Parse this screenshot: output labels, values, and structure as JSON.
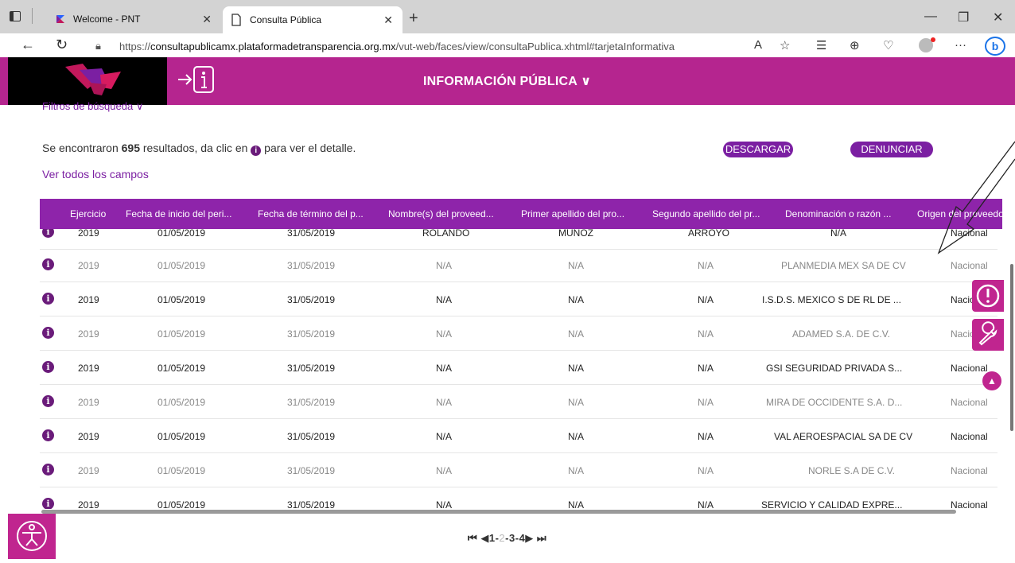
{
  "browser": {
    "tabs": [
      {
        "title": "Welcome - PNT",
        "active": false
      },
      {
        "title": "Consulta Pública",
        "active": true
      }
    ],
    "url_prefix": "https://",
    "url_host": "consultapublicamx.plataformadetransparencia.org.mx",
    "url_path": "/vut-web/faces/view/consultaPublica.xhtml#tarjetaInformativa"
  },
  "header": {
    "title": "INFORMACIÓN PÚBLICA"
  },
  "filters_label": "Filtros de búsqueda",
  "results": {
    "prefix": "Se encontraron ",
    "count": "695",
    "middle": " resultados, da clic en ",
    "suffix": " para ver el detalle."
  },
  "buttons": {
    "download": "DESCARGAR",
    "report": "DENUNCIAR"
  },
  "view_all": "Ver todos los campos",
  "table": {
    "headers": [
      "Ejercicio",
      "Fecha de inicio del peri...",
      "Fecha de término del p...",
      "Nombre(s) del proveed...",
      "Primer apellido del pro...",
      "Segundo apellido del pr...",
      "Denominación o razón ...",
      "Origen del proveedor"
    ],
    "partial_row": [
      "2019",
      "01/05/2019",
      "31/05/2019",
      "ROLANDO",
      "MUÑOZ",
      "ARROYO",
      "N/A",
      "Nacional"
    ],
    "rows": [
      {
        "ejercicio": "2019",
        "inicio": "01/05/2019",
        "termino": "31/05/2019",
        "nombre": "N/A",
        "ap1": "N/A",
        "ap2": "N/A",
        "razon": "PLANMEDIA MEX SA DE CV",
        "origen": "Nacional"
      },
      {
        "ejercicio": "2019",
        "inicio": "01/05/2019",
        "termino": "31/05/2019",
        "nombre": "N/A",
        "ap1": "N/A",
        "ap2": "N/A",
        "razon": "I.S.D.S. MEXICO S DE RL DE ...",
        "origen": "Nacional"
      },
      {
        "ejercicio": "2019",
        "inicio": "01/05/2019",
        "termino": "31/05/2019",
        "nombre": "N/A",
        "ap1": "N/A",
        "ap2": "N/A",
        "razon": "ADAMED S.A. DE C.V.",
        "origen": "Nacional"
      },
      {
        "ejercicio": "2019",
        "inicio": "01/05/2019",
        "termino": "31/05/2019",
        "nombre": "N/A",
        "ap1": "N/A",
        "ap2": "N/A",
        "razon": "GSI SEGURIDAD PRIVADA S...",
        "origen": "Nacional"
      },
      {
        "ejercicio": "2019",
        "inicio": "01/05/2019",
        "termino": "31/05/2019",
        "nombre": "N/A",
        "ap1": "N/A",
        "ap2": "N/A",
        "razon": "MIRA DE OCCIDENTE S.A. D...",
        "origen": "Nacional"
      },
      {
        "ejercicio": "2019",
        "inicio": "01/05/2019",
        "termino": "31/05/2019",
        "nombre": "N/A",
        "ap1": "N/A",
        "ap2": "N/A",
        "razon": "VAL AEROESPACIAL SA DE CV",
        "origen": "Nacional"
      },
      {
        "ejercicio": "2019",
        "inicio": "01/05/2019",
        "termino": "31/05/2019",
        "nombre": "N/A",
        "ap1": "N/A",
        "ap2": "N/A",
        "razon": "NORLE S.A DE C.V.",
        "origen": "Nacional"
      },
      {
        "ejercicio": "2019",
        "inicio": "01/05/2019",
        "termino": "31/05/2019",
        "nombre": "N/A",
        "ap1": "N/A",
        "ap2": "N/A",
        "razon": "SERVICIO Y CALIDAD EXPRE...",
        "origen": "Nacional"
      }
    ]
  },
  "pager": {
    "pages": [
      "1",
      "2",
      "3",
      "4"
    ],
    "current": "2"
  },
  "colors": {
    "brand": "#b5258f",
    "table_header": "#8e24aa",
    "accent": "#7b1fa2"
  }
}
